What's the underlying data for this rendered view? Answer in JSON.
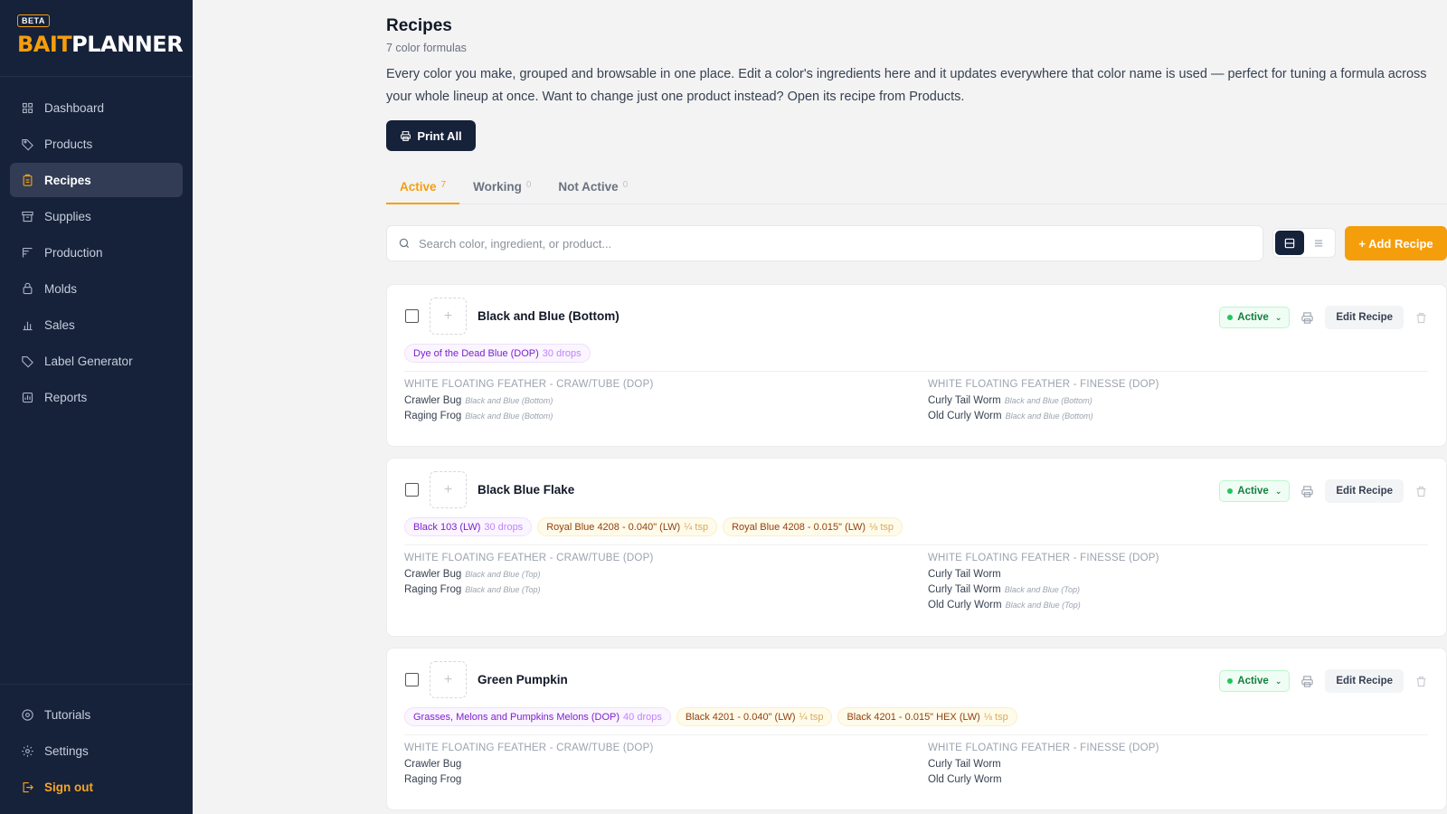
{
  "brand": {
    "badge": "BETA",
    "name_part1": "BAIT",
    "name_part2": "PLANNER"
  },
  "nav": {
    "items": [
      {
        "label": "Dashboard",
        "icon": "grid-icon"
      },
      {
        "label": "Products",
        "icon": "tag-icon"
      },
      {
        "label": "Recipes",
        "icon": "clipboard-icon",
        "active": true
      },
      {
        "label": "Supplies",
        "icon": "archive-icon"
      },
      {
        "label": "Production",
        "icon": "production-icon"
      },
      {
        "label": "Molds",
        "icon": "mold-icon"
      },
      {
        "label": "Sales",
        "icon": "bar-chart-icon"
      },
      {
        "label": "Label Generator",
        "icon": "label-icon"
      },
      {
        "label": "Reports",
        "icon": "report-icon"
      }
    ],
    "bottom": [
      {
        "label": "Tutorials",
        "icon": "play-circle-icon"
      },
      {
        "label": "Settings",
        "icon": "gear-icon"
      },
      {
        "label": "Sign out",
        "icon": "sign-out-icon"
      }
    ]
  },
  "page": {
    "title": "Recipes",
    "subtitle": "7 color formulas",
    "description": "Every color you make, grouped and browsable in one place. Edit a color's ingredients here and it updates everywhere that color name is used — perfect for tuning a formula across your whole lineup at once. Want to change just one product instead? Open its recipe from Products.",
    "print_all": "Print All"
  },
  "tabs": [
    {
      "label": "Active",
      "count": "7"
    },
    {
      "label": "Working",
      "count": "0"
    },
    {
      "label": "Not Active",
      "count": "0"
    }
  ],
  "search": {
    "placeholder": "Search color, ingredient, or product..."
  },
  "add_recipe": "+ Add Recipe",
  "card_labels": {
    "status": "Active",
    "edit": "Edit Recipe"
  },
  "colors": {
    "accent": "#f59e0b",
    "sidebar": "#16213a",
    "active_green": "#15803d"
  },
  "recipes": [
    {
      "name": "Black and Blue (Bottom)",
      "ingredients": [
        {
          "name": "Dye of the Dead Blue (DOP)",
          "amount": "30 drops",
          "tone": "purple"
        }
      ],
      "groups": [
        {
          "title": "WHITE FLOATING FEATHER - CRAW/TUBE (DOP)",
          "items": [
            {
              "name": "Crawler Bug",
              "note": "Black and Blue (Bottom)"
            },
            {
              "name": "Raging Frog",
              "note": "Black and Blue (Bottom)"
            }
          ]
        },
        {
          "title": "WHITE FLOATING FEATHER - FINESSE (DOP)",
          "items": [
            {
              "name": "Curly Tail Worm",
              "note": "Black and Blue (Bottom)"
            },
            {
              "name": "Old Curly Worm",
              "note": "Black and Blue (Bottom)"
            }
          ]
        }
      ]
    },
    {
      "name": "Black Blue Flake",
      "ingredients": [
        {
          "name": "Black 103 (LW)",
          "amount": "30 drops",
          "tone": "purple"
        },
        {
          "name": "Royal Blue 4208 - 0.040\" (LW)",
          "amount": "¼ tsp",
          "tone": "amber"
        },
        {
          "name": "Royal Blue 4208 - 0.015\" (LW)",
          "amount": "⅛ tsp",
          "tone": "amber"
        }
      ],
      "groups": [
        {
          "title": "WHITE FLOATING FEATHER - CRAW/TUBE (DOP)",
          "items": [
            {
              "name": "Crawler Bug",
              "note": "Black and Blue (Top)"
            },
            {
              "name": "Raging Frog",
              "note": "Black and Blue (Top)"
            }
          ]
        },
        {
          "title": "WHITE FLOATING FEATHER - FINESSE (DOP)",
          "items": [
            {
              "name": "Curly Tail Worm",
              "note": ""
            },
            {
              "name": "Curly Tail Worm",
              "note": "Black and Blue (Top)"
            },
            {
              "name": "Old Curly Worm",
              "note": "Black and Blue (Top)"
            }
          ]
        }
      ]
    },
    {
      "name": "Green Pumpkin",
      "ingredients": [
        {
          "name": "Grasses, Melons and Pumpkins Melons (DOP)",
          "amount": "40 drops",
          "tone": "purple"
        },
        {
          "name": "Black 4201 - 0.040\" (LW)",
          "amount": "¼ tsp",
          "tone": "amber"
        },
        {
          "name": "Black 4201 - 0.015\" HEX (LW)",
          "amount": "⅛ tsp",
          "tone": "amber"
        }
      ],
      "groups": [
        {
          "title": "WHITE FLOATING FEATHER - CRAW/TUBE (DOP)",
          "items": [
            {
              "name": "Crawler Bug",
              "note": ""
            },
            {
              "name": "Raging Frog",
              "note": ""
            }
          ]
        },
        {
          "title": "WHITE FLOATING FEATHER - FINESSE (DOP)",
          "items": [
            {
              "name": "Curly Tail Worm",
              "note": ""
            },
            {
              "name": "Old Curly Worm",
              "note": ""
            }
          ]
        }
      ]
    }
  ]
}
